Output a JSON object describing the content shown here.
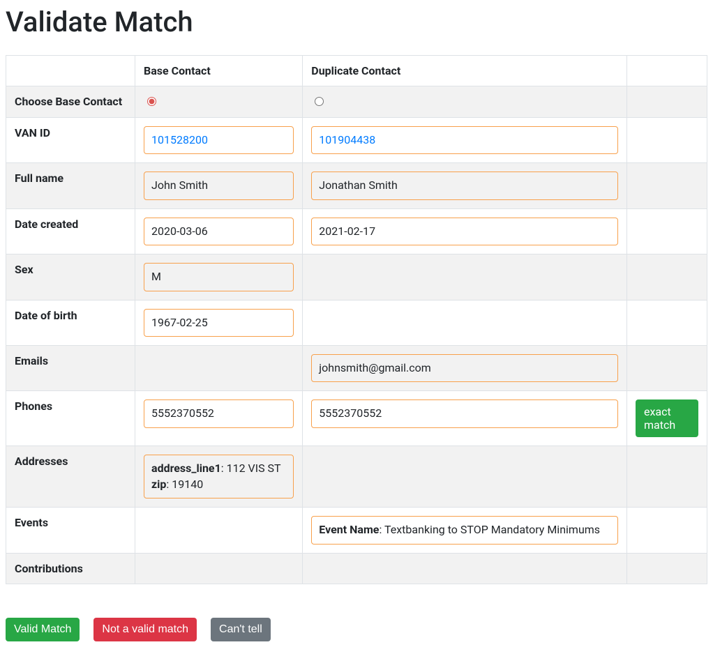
{
  "title": "Validate Match",
  "columns": {
    "base": "Base Contact",
    "duplicate": "Duplicate Contact"
  },
  "rows": {
    "choose": {
      "label": "Choose Base Contact"
    },
    "van_id": {
      "label": "VAN ID",
      "base": "101528200",
      "dup": "101904438"
    },
    "full_name": {
      "label": "Full name",
      "base": "John Smith",
      "dup": "Jonathan Smith"
    },
    "date_created": {
      "label": "Date created",
      "base": "2020-03-06",
      "dup": "2021-02-17"
    },
    "sex": {
      "label": "Sex",
      "base": "M"
    },
    "dob": {
      "label": "Date of birth",
      "base": "1967-02-25"
    },
    "emails": {
      "label": "Emails",
      "dup": "johnsmith@gmail.com"
    },
    "phones": {
      "label": "Phones",
      "base": "5552370552",
      "dup": "5552370552",
      "match": "exact match"
    },
    "addresses": {
      "label": "Addresses",
      "base_line1_key": "address_line1",
      "base_line1_val": ": 112 VIS ST",
      "base_zip_key": "zip",
      "base_zip_val": ": 19140"
    },
    "events": {
      "label": "Events",
      "dup_key": "Event Name",
      "dup_val": ": Textbanking to STOP Mandatory Minimums"
    },
    "contributions": {
      "label": "Contributions"
    }
  },
  "actions": {
    "valid": "Valid Match",
    "invalid": "Not a valid match",
    "unsure": "Can't tell"
  }
}
